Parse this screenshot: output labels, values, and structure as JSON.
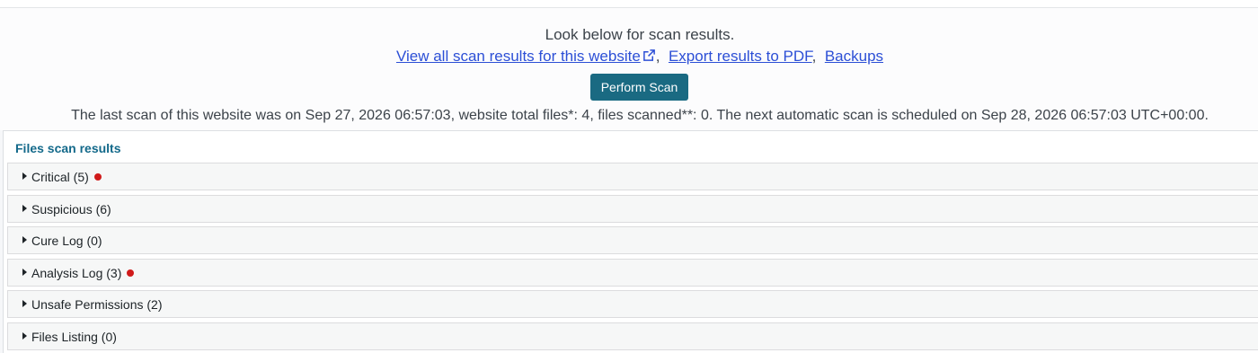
{
  "header": {
    "intro_text": "Look below for scan results.",
    "links": {
      "view_all": "View all scan results for this website",
      "separator": ",",
      "export_pdf": "Export results to PDF",
      "backups": "Backups"
    },
    "perform_scan_label": "Perform Scan",
    "last_scan_text": "The last scan of this website was on Sep 27, 2026 06:57:03, website total files*: 4, files scanned**: 0. The next automatic scan is scheduled on Sep 28, 2026 06:57:03 UTC+00:00."
  },
  "results": {
    "title": "Files scan results",
    "sections": [
      {
        "label": "Critical (5)",
        "has_alert": true
      },
      {
        "label": "Suspicious (6)",
        "has_alert": false
      },
      {
        "label": "Cure Log (0)",
        "has_alert": false
      },
      {
        "label": "Analysis Log (3)",
        "has_alert": true
      },
      {
        "label": "Unsafe Permissions (2)",
        "has_alert": false
      },
      {
        "label": "Files Listing (0)",
        "has_alert": false
      }
    ]
  },
  "colors": {
    "link": "#2c4fd6",
    "button": "#1a6a82",
    "title_accent": "#13698a",
    "alert_dot": "#d01a1a"
  },
  "icons": {
    "external_link": "external-link-icon",
    "expand": "triangle-right-icon",
    "alert": "red-dot-icon"
  }
}
